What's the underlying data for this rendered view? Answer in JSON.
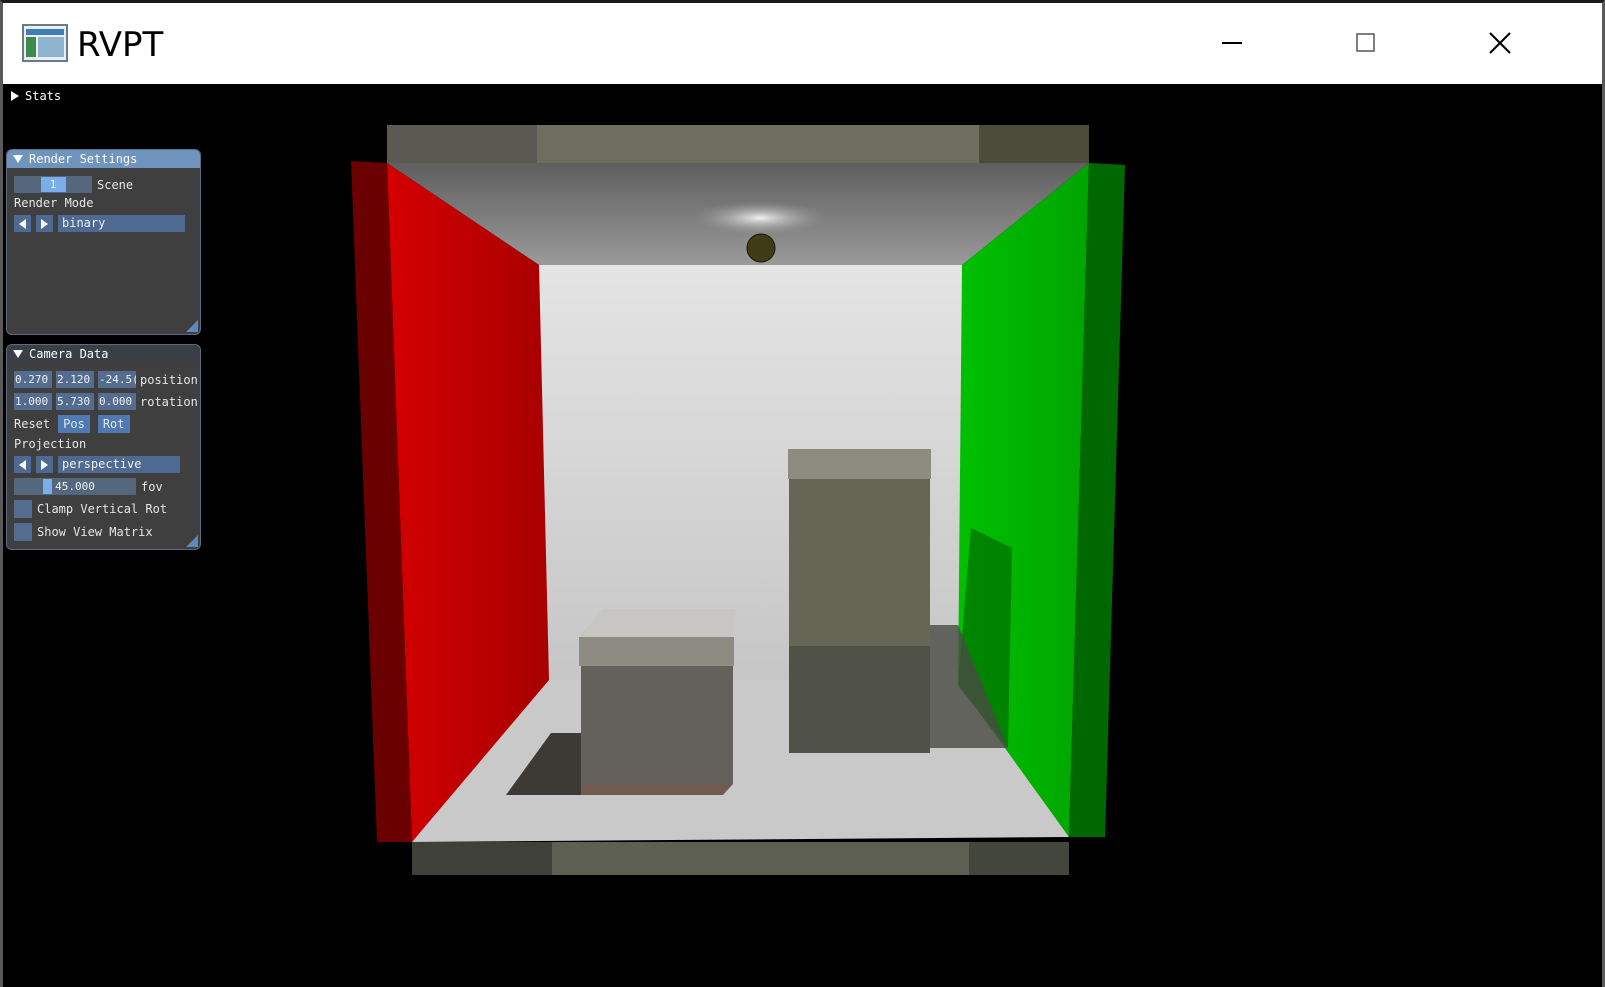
{
  "window": {
    "title": "RVPT"
  },
  "stats": {
    "label": "Stats"
  },
  "render_settings": {
    "title": "Render Settings",
    "scene_value": "1",
    "scene_label": "Scene",
    "render_mode_label": "Render Mode",
    "render_mode_value": "binary"
  },
  "camera_data": {
    "title": "Camera Data",
    "position": [
      "0.270",
      "2.120",
      "-24.5("
    ],
    "position_label": "position",
    "rotation": [
      "1.000",
      "5.730",
      "0.000"
    ],
    "rotation_label": "rotation",
    "reset_label": "Reset",
    "pos_button": "Pos",
    "rot_button": "Rot",
    "projection_label": "Projection",
    "projection_value": "perspective",
    "fov_value": "45.000",
    "fov_label": "fov",
    "clamp_label": "Clamp Vertical Rot",
    "show_matrix_label": "Show View Matrix"
  },
  "colors": {
    "accent": "#6f94bd",
    "panel_bg": "#3f3f40",
    "widget": "#536c8f",
    "red_wall": "#c00000",
    "green_wall": "#00b800"
  },
  "icons": [
    "app-icon",
    "minimize-icon",
    "maximize-icon",
    "close-icon",
    "collapse-arrow-icon",
    "resize-grip-icon"
  ]
}
